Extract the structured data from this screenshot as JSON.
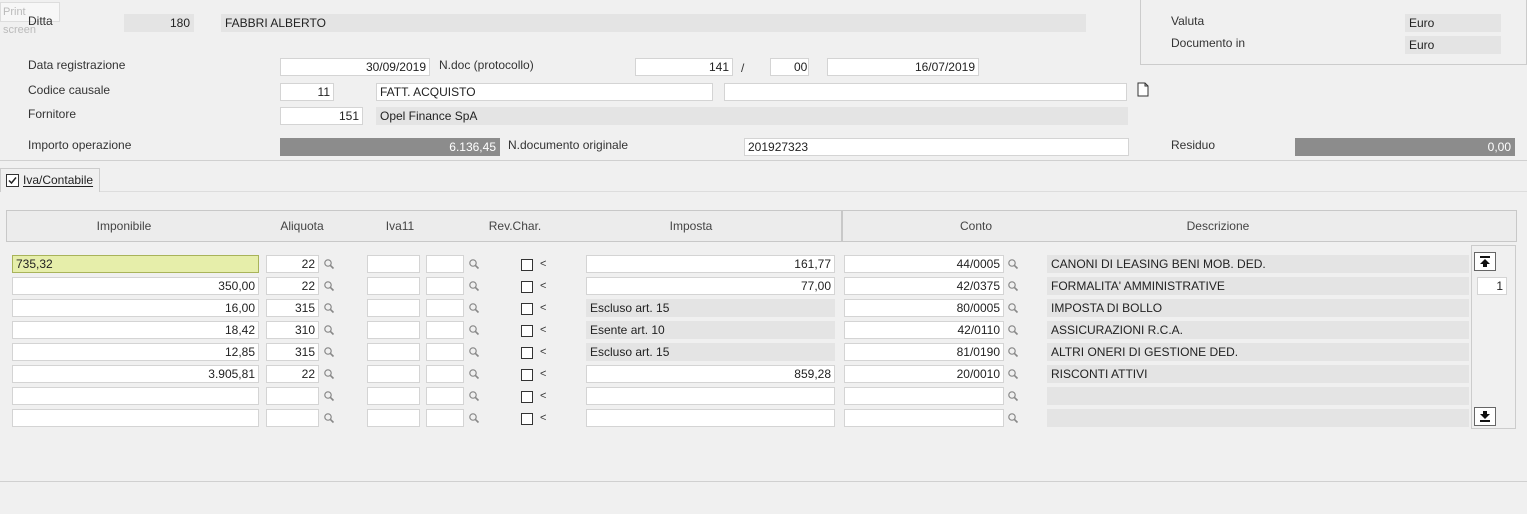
{
  "print_screen_label": "Print screen",
  "header": {
    "ditta_label": "Ditta",
    "ditta_code": "180",
    "ditta_name": "FABBRI ALBERTO",
    "valuta_label": "Valuta",
    "valuta_value": "Euro",
    "documento_in_label": "Documento in",
    "documento_in_value": "Euro",
    "data_registrazione_label": "Data registrazione",
    "data_registrazione": "30/09/2019",
    "ndoc_label": "N.doc (protocollo)",
    "ndoc_value": "141",
    "ndoc_sep": "/",
    "ndoc_suffix": "00",
    "doc_date": "16/07/2019",
    "codice_causale_label": "Codice causale",
    "codice_causale": "11",
    "causale_desc": "FATT. ACQUISTO",
    "causale_extra": "",
    "fornitore_label": "Fornitore",
    "fornitore_code": "151",
    "fornitore_name": "Opel Finance SpA",
    "importo_label": "Importo operazione",
    "importo_value": "6.136,45",
    "ndoc_originale_label": "N.documento originale",
    "ndoc_originale_value": "201927323",
    "residuo_label": "Residuo",
    "residuo_value": "0,00"
  },
  "tab": {
    "label": "Iva/Contabile"
  },
  "grid": {
    "columns": {
      "imponibile": "Imponibile",
      "aliquota": "Aliquota",
      "iva11": "Iva11",
      "rev_char": "Rev.Char.",
      "imposta": "Imposta",
      "conto": "Conto",
      "descrizione": "Descrizione"
    },
    "rev_marker": "<",
    "page_number": "1",
    "rows": [
      {
        "imponibile": "735,32",
        "aliquota": "22",
        "imposta": "161,77",
        "conto": "44/0005",
        "descrizione": "CANONI DI LEASING BENI MOB. DED."
      },
      {
        "imponibile": "350,00",
        "aliquota": "22",
        "imposta": "77,00",
        "conto": "42/0375",
        "descrizione": "FORMALITA' AMMINISTRATIVE"
      },
      {
        "imponibile": "16,00",
        "aliquota": "315",
        "imposta": "Escluso art. 15",
        "conto": "80/0005",
        "descrizione": "IMPOSTA DI BOLLO"
      },
      {
        "imponibile": "18,42",
        "aliquota": "310",
        "imposta": "Esente art. 10",
        "conto": "42/0110",
        "descrizione": "ASSICURAZIONI R.C.A."
      },
      {
        "imponibile": "12,85",
        "aliquota": "315",
        "imposta": "Escluso art. 15",
        "conto": "81/0190",
        "descrizione": "ALTRI ONERI DI GESTIONE DED."
      },
      {
        "imponibile": "3.905,81",
        "aliquota": "22",
        "imposta": "859,28",
        "conto": "20/0010",
        "descrizione": "RISCONTI ATTIVI"
      },
      {
        "imponibile": "",
        "aliquota": "",
        "imposta": "",
        "conto": "",
        "descrizione": ""
      },
      {
        "imponibile": "",
        "aliquota": "",
        "imposta": "",
        "conto": "",
        "descrizione": ""
      }
    ]
  }
}
